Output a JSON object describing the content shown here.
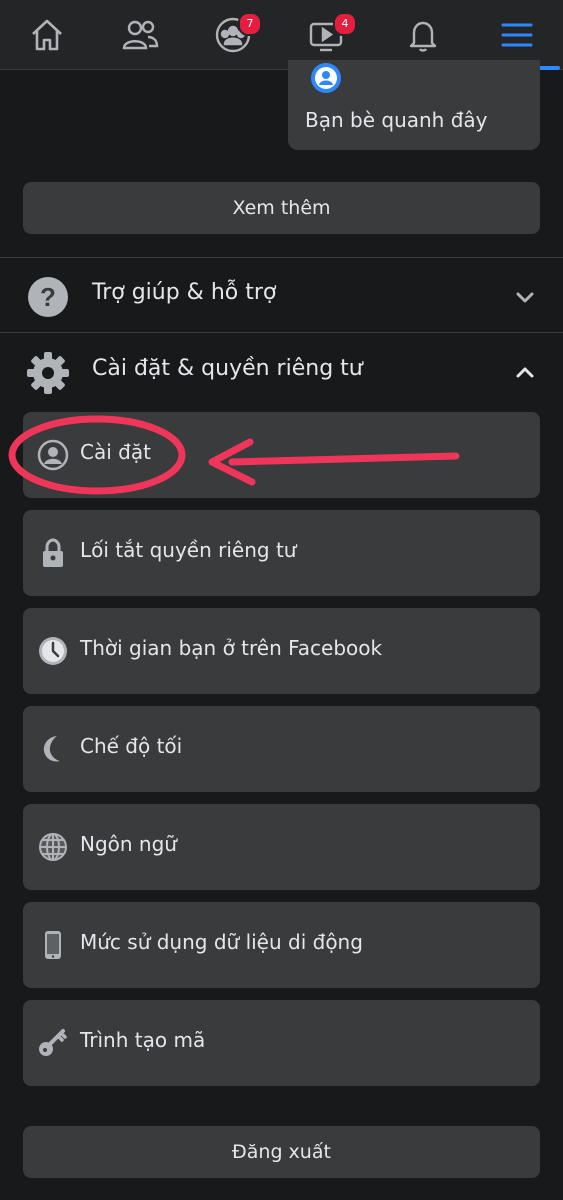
{
  "nav": {
    "home": {
      "icon": "home-icon"
    },
    "friends": {
      "icon": "friends-icon"
    },
    "groups": {
      "icon": "groups-icon",
      "badge": "7"
    },
    "watch": {
      "icon": "watch-icon",
      "badge": "4"
    },
    "notifications": {
      "icon": "bell-icon"
    },
    "menu": {
      "icon": "menu-icon",
      "active": true
    }
  },
  "shortcuts": {
    "nearby_friends": "Bạn bè quanh đây",
    "see_more": "Xem thêm"
  },
  "sections": {
    "help": {
      "label": "Trợ giúp & hỗ trợ",
      "expanded": false
    },
    "settings_privacy": {
      "label": "Cài đặt & quyền riêng tư",
      "expanded": true
    }
  },
  "settings_items": [
    {
      "label": "Cài đặt",
      "icon": "account-circle-icon"
    },
    {
      "label": "Lối tắt quyền riêng tư",
      "icon": "lock-icon"
    },
    {
      "label": "Thời gian bạn ở trên Facebook",
      "icon": "clock-icon"
    },
    {
      "label": "Chế độ tối",
      "icon": "moon-icon"
    },
    {
      "label": "Ngôn ngữ",
      "icon": "globe-icon"
    },
    {
      "label": "Mức sử dụng dữ liệu di động",
      "icon": "phone-icon"
    },
    {
      "label": "Trình tạo mã",
      "icon": "key-icon"
    }
  ],
  "logout": "Đăng xuất",
  "colors": {
    "background": "#18191a",
    "surface": "#3a3b3c",
    "accent": "#2d88ff",
    "badge": "#e41e3f",
    "annotation": "#f0355a"
  }
}
